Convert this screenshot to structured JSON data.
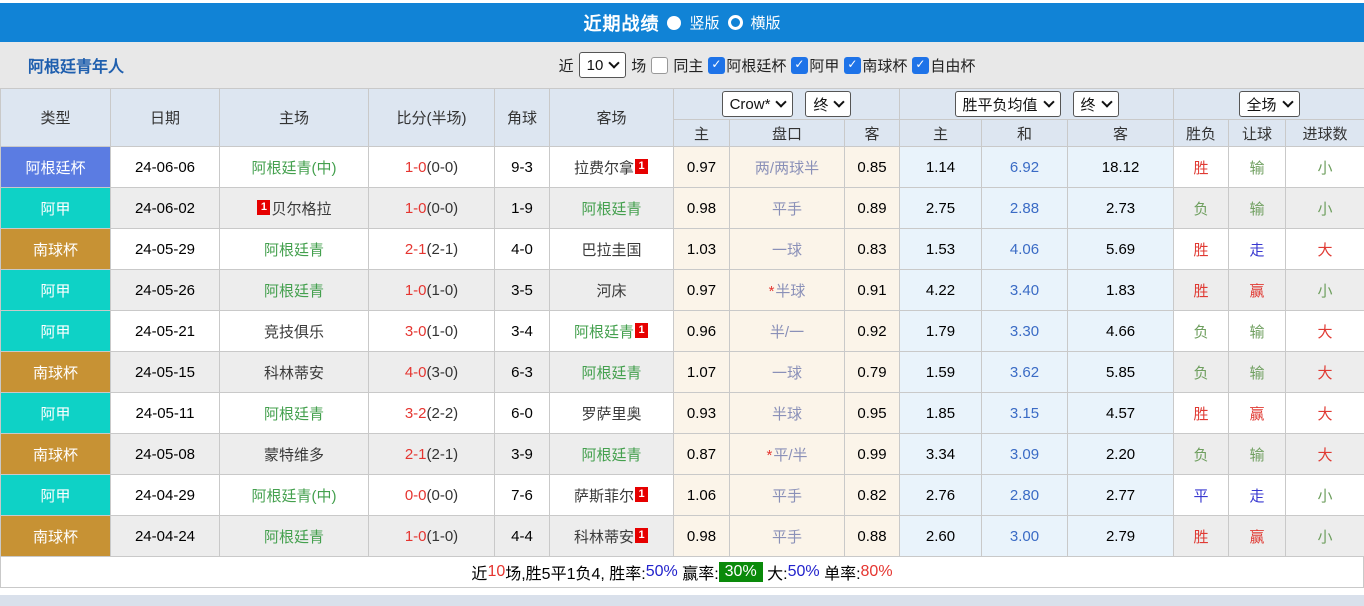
{
  "title_bar": {
    "title": "近期战绩",
    "vertical_label": "竖版",
    "horizontal_label": "横版"
  },
  "toolbar": {
    "team_name": "阿根廷青年人",
    "near_label": "近",
    "games_count": "10",
    "games_label": "场",
    "same_home_label": "同主",
    "leagues": [
      {
        "label": "阿根廷杯"
      },
      {
        "label": "阿甲"
      },
      {
        "label": "南球杯"
      },
      {
        "label": "自由杯"
      }
    ]
  },
  "table": {
    "selects": {
      "odds_company": "Crow*",
      "final1": "终",
      "avg": "胜平负均值",
      "final2": "终",
      "scope": "全场"
    },
    "columns": [
      "类型",
      "日期",
      "主场",
      "比分(半场)",
      "角球",
      "客场"
    ],
    "sub_columns": [
      "主",
      "盘口",
      "客",
      "主",
      "和",
      "客",
      "胜负",
      "让球",
      "进球数"
    ],
    "rows": [
      {
        "league": "阿根廷杯",
        "league_color": "#5b7ce2",
        "date": "24-06-06",
        "home": {
          "name": "阿根廷青(中)",
          "green": true,
          "badge": null,
          "badge_pos": null
        },
        "score": "1-0",
        "half": "(0-0)",
        "corner": "9-3",
        "away": {
          "name": "拉费尔拿",
          "green": false,
          "badge": "1",
          "badge_pos": "after"
        },
        "asian": {
          "home": "0.97",
          "line": "两/两球半",
          "away": "0.85",
          "star": false
        },
        "euro": {
          "home": "1.14",
          "draw": "6.92",
          "away": "18.12"
        },
        "result": {
          "text": "胜",
          "color": "red"
        },
        "handicap_result": {
          "text": "输",
          "color": "green"
        },
        "goals": {
          "text": "小",
          "color": "green"
        }
      },
      {
        "league": "阿甲",
        "league_color": "#0ed2c6",
        "date": "24-06-02",
        "home": {
          "name": "贝尔格拉",
          "green": false,
          "badge": "1",
          "badge_pos": "before"
        },
        "score": "1-0",
        "half": "(0-0)",
        "corner": "1-9",
        "away": {
          "name": "阿根廷青",
          "green": true,
          "badge": null,
          "badge_pos": null
        },
        "asian": {
          "home": "0.98",
          "line": "平手",
          "away": "0.89",
          "star": false
        },
        "euro": {
          "home": "2.75",
          "draw": "2.88",
          "away": "2.73"
        },
        "result": {
          "text": "负",
          "color": "green"
        },
        "handicap_result": {
          "text": "输",
          "color": "green"
        },
        "goals": {
          "text": "小",
          "color": "green"
        }
      },
      {
        "league": "南球杯",
        "league_color": "#c79234",
        "date": "24-05-29",
        "home": {
          "name": "阿根廷青",
          "green": true,
          "badge": null,
          "badge_pos": null
        },
        "score": "2-1",
        "half": "(2-1)",
        "corner": "4-0",
        "away": {
          "name": "巴拉圭国",
          "green": false,
          "badge": null,
          "badge_pos": null
        },
        "asian": {
          "home": "1.03",
          "line": "一球",
          "away": "0.83",
          "star": false
        },
        "euro": {
          "home": "1.53",
          "draw": "4.06",
          "away": "5.69"
        },
        "result": {
          "text": "胜",
          "color": "red"
        },
        "handicap_result": {
          "text": "走",
          "color": "blue"
        },
        "goals": {
          "text": "大",
          "color": "red"
        }
      },
      {
        "league": "阿甲",
        "league_color": "#0ed2c6",
        "date": "24-05-26",
        "home": {
          "name": "阿根廷青",
          "green": true,
          "badge": null,
          "badge_pos": null
        },
        "score": "1-0",
        "half": "(1-0)",
        "corner": "3-5",
        "away": {
          "name": "河床",
          "green": false,
          "badge": null,
          "badge_pos": null
        },
        "asian": {
          "home": "0.97",
          "line": "半球",
          "away": "0.91",
          "star": true
        },
        "euro": {
          "home": "4.22",
          "draw": "3.40",
          "away": "1.83"
        },
        "result": {
          "text": "胜",
          "color": "red"
        },
        "handicap_result": {
          "text": "赢",
          "color": "red"
        },
        "goals": {
          "text": "小",
          "color": "green"
        }
      },
      {
        "league": "阿甲",
        "league_color": "#0ed2c6",
        "date": "24-05-21",
        "home": {
          "name": "竞技俱乐",
          "green": false,
          "badge": null,
          "badge_pos": null
        },
        "score": "3-0",
        "half": "(1-0)",
        "corner": "3-4",
        "away": {
          "name": "阿根廷青",
          "green": true,
          "badge": "1",
          "badge_pos": "after"
        },
        "asian": {
          "home": "0.96",
          "line": "半/一",
          "away": "0.92",
          "star": false
        },
        "euro": {
          "home": "1.79",
          "draw": "3.30",
          "away": "4.66"
        },
        "result": {
          "text": "负",
          "color": "green"
        },
        "handicap_result": {
          "text": "输",
          "color": "green"
        },
        "goals": {
          "text": "大",
          "color": "red"
        }
      },
      {
        "league": "南球杯",
        "league_color": "#c79234",
        "date": "24-05-15",
        "home": {
          "name": "科林蒂安",
          "green": false,
          "badge": null,
          "badge_pos": null
        },
        "score": "4-0",
        "half": "(3-0)",
        "corner": "6-3",
        "away": {
          "name": "阿根廷青",
          "green": true,
          "badge": null,
          "badge_pos": null
        },
        "asian": {
          "home": "1.07",
          "line": "一球",
          "away": "0.79",
          "star": false
        },
        "euro": {
          "home": "1.59",
          "draw": "3.62",
          "away": "5.85"
        },
        "result": {
          "text": "负",
          "color": "green"
        },
        "handicap_result": {
          "text": "输",
          "color": "green"
        },
        "goals": {
          "text": "大",
          "color": "red"
        }
      },
      {
        "league": "阿甲",
        "league_color": "#0ed2c6",
        "date": "24-05-11",
        "home": {
          "name": "阿根廷青",
          "green": true,
          "badge": null,
          "badge_pos": null
        },
        "score": "3-2",
        "half": "(2-2)",
        "corner": "6-0",
        "away": {
          "name": "罗萨里奥",
          "green": false,
          "badge": null,
          "badge_pos": null
        },
        "asian": {
          "home": "0.93",
          "line": "半球",
          "away": "0.95",
          "star": false
        },
        "euro": {
          "home": "1.85",
          "draw": "3.15",
          "away": "4.57"
        },
        "result": {
          "text": "胜",
          "color": "red"
        },
        "handicap_result": {
          "text": "赢",
          "color": "red"
        },
        "goals": {
          "text": "大",
          "color": "red"
        }
      },
      {
        "league": "南球杯",
        "league_color": "#c79234",
        "date": "24-05-08",
        "home": {
          "name": "蒙特维多",
          "green": false,
          "badge": null,
          "badge_pos": null
        },
        "score": "2-1",
        "half": "(2-1)",
        "corner": "3-9",
        "away": {
          "name": "阿根廷青",
          "green": true,
          "badge": null,
          "badge_pos": null
        },
        "asian": {
          "home": "0.87",
          "line": "平/半",
          "away": "0.99",
          "star": true
        },
        "euro": {
          "home": "3.34",
          "draw": "3.09",
          "away": "2.20"
        },
        "result": {
          "text": "负",
          "color": "green"
        },
        "handicap_result": {
          "text": "输",
          "color": "green"
        },
        "goals": {
          "text": "大",
          "color": "red"
        }
      },
      {
        "league": "阿甲",
        "league_color": "#0ed2c6",
        "date": "24-04-29",
        "home": {
          "name": "阿根廷青(中)",
          "green": true,
          "badge": null,
          "badge_pos": null
        },
        "score": "0-0",
        "half": "(0-0)",
        "corner": "7-6",
        "away": {
          "name": "萨斯菲尔",
          "green": false,
          "badge": "1",
          "badge_pos": "after"
        },
        "asian": {
          "home": "1.06",
          "line": "平手",
          "away": "0.82",
          "star": false
        },
        "euro": {
          "home": "2.76",
          "draw": "2.80",
          "away": "2.77"
        },
        "result": {
          "text": "平",
          "color": "blue"
        },
        "handicap_result": {
          "text": "走",
          "color": "blue"
        },
        "goals": {
          "text": "小",
          "color": "green"
        }
      },
      {
        "league": "南球杯",
        "league_color": "#c79234",
        "date": "24-04-24",
        "home": {
          "name": "阿根廷青",
          "green": true,
          "badge": null,
          "badge_pos": null
        },
        "score": "1-0",
        "half": "(1-0)",
        "corner": "4-4",
        "away": {
          "name": "科林蒂安",
          "green": false,
          "badge": "1",
          "badge_pos": "after"
        },
        "asian": {
          "home": "0.98",
          "line": "平手",
          "away": "0.88",
          "star": false
        },
        "euro": {
          "home": "2.60",
          "draw": "3.00",
          "away": "2.79"
        },
        "result": {
          "text": "胜",
          "color": "red"
        },
        "handicap_result": {
          "text": "赢",
          "color": "red"
        },
        "goals": {
          "text": "小",
          "color": "green"
        }
      }
    ]
  },
  "summary": {
    "segments": [
      {
        "text": "近",
        "color": "#000000",
        "bg": null
      },
      {
        "text": "10",
        "color": "#e53530",
        "bg": null
      },
      {
        "text": "场,胜5平1负4, 胜率:",
        "color": "#000000",
        "bg": null
      },
      {
        "text": "50%",
        "color": "#2222cc",
        "bg": null
      },
      {
        "text": " 赢率:",
        "color": "#000000",
        "bg": null
      },
      {
        "text": "30%",
        "color": "#ffffff",
        "bg": "#0a8a0a"
      },
      {
        "text": " 大:",
        "color": "#000000",
        "bg": null
      },
      {
        "text": "50%",
        "color": "#2222cc",
        "bg": null
      },
      {
        "text": " 单率:",
        "color": "#000000",
        "bg": null
      },
      {
        "text": "80%",
        "color": "#e53530",
        "bg": null
      }
    ]
  },
  "colors": {
    "titlebar": "#1183d6",
    "toolbar_bg": "#e8e8e8",
    "header_bg": "#dde6f1",
    "league_cup": "#5b7ce2",
    "league_primera": "#0ed2c6",
    "league_sudamericana": "#c79234",
    "team_green": "#44a04e",
    "score_red": "#e53530",
    "handicap_text": "#8a90b8",
    "draw_odds_blue": "#3a6bc5",
    "asian_bg": "#fbf4e9",
    "euro_bg": "#e9f3fb"
  }
}
